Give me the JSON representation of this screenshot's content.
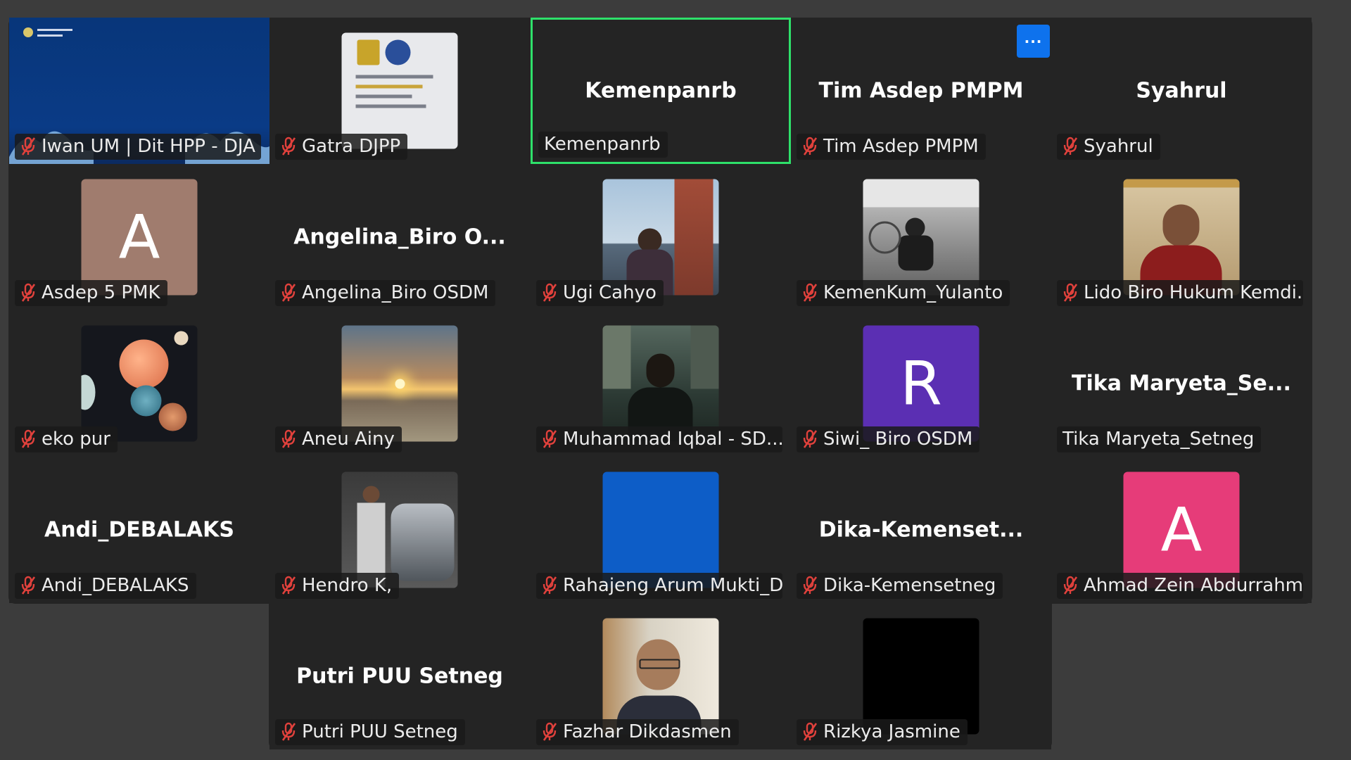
{
  "tiles": [
    {
      "row": 0,
      "col": 0,
      "name": "Iwan UM | Dit HPP - DJA",
      "center": "",
      "muted": true,
      "avatar": null,
      "photo": "slide-blue"
    },
    {
      "row": 0,
      "col": 1,
      "name": "Gatra DJPP",
      "center": "",
      "muted": true,
      "avatar": null,
      "photo": "document"
    },
    {
      "row": 0,
      "col": 2,
      "name": "Kemenpanrb",
      "center": "Kemenpanrb",
      "muted": false,
      "avatar": null,
      "photo": null,
      "active": true
    },
    {
      "row": 0,
      "col": 3,
      "name": "Tim Asdep PMPM",
      "center": "Tim Asdep PMPM",
      "muted": true,
      "avatar": null,
      "photo": null
    },
    {
      "row": 0,
      "col": 4,
      "name": "Syahrul",
      "center": "Syahrul",
      "muted": true,
      "avatar": null,
      "photo": null
    },
    {
      "row": 1,
      "col": 0,
      "name": "Asdep 5 PMK",
      "center": "",
      "muted": true,
      "avatar": {
        "letter": "A",
        "color": "#a07c6e"
      },
      "photo": null
    },
    {
      "row": 1,
      "col": 1,
      "name": "Angelina_Biro OSDM",
      "center": "Angelina_Biro  O...",
      "muted": true,
      "avatar": null,
      "photo": null
    },
    {
      "row": 1,
      "col": 2,
      "name": "Ugi Cahyo",
      "center": "",
      "muted": true,
      "avatar": null,
      "photo": "tower"
    },
    {
      "row": 1,
      "col": 3,
      "name": "KemenKum_Yulanto",
      "center": "",
      "muted": true,
      "avatar": null,
      "photo": "bw"
    },
    {
      "row": 1,
      "col": 4,
      "name": "Lido Biro Hukum Kemdi...",
      "center": "",
      "muted": true,
      "avatar": null,
      "photo": "portrait-red"
    },
    {
      "row": 2,
      "col": 0,
      "name": "eko pur",
      "center": "",
      "muted": true,
      "avatar": null,
      "photo": "planets"
    },
    {
      "row": 2,
      "col": 1,
      "name": "Aneu Ainy",
      "center": "",
      "muted": true,
      "avatar": null,
      "photo": "sunset"
    },
    {
      "row": 2,
      "col": 2,
      "name": "Muhammad Iqbal - SD...",
      "center": "",
      "muted": true,
      "avatar": null,
      "photo": "street"
    },
    {
      "row": 2,
      "col": 3,
      "name": "Siwi_ Biro OSDM",
      "center": "",
      "muted": true,
      "avatar": {
        "letter": "R",
        "color": "#5b2fb3"
      },
      "photo": null
    },
    {
      "row": 2,
      "col": 4,
      "name": "Tika Maryeta_Setneg",
      "center": "Tika  Maryeta_Se...",
      "muted": false,
      "avatar": null,
      "photo": null
    },
    {
      "row": 3,
      "col": 0,
      "name": "Andi_DEBALAKS",
      "center": "Andi_DEBALAKS",
      "muted": true,
      "avatar": null,
      "photo": null
    },
    {
      "row": 3,
      "col": 1,
      "name": "Hendro K,",
      "center": "",
      "muted": true,
      "avatar": null,
      "photo": "motorbike"
    },
    {
      "row": 3,
      "col": 2,
      "name": "Rahajeng Arum Mukti_Di...",
      "center": "",
      "muted": true,
      "avatar": null,
      "photo": "blue"
    },
    {
      "row": 3,
      "col": 3,
      "name": "Dika-Kemensetneg",
      "center": "Dika-Kemenset...",
      "muted": true,
      "avatar": null,
      "photo": null
    },
    {
      "row": 3,
      "col": 4,
      "name": "Ahmad Zein Abdurrahm...",
      "center": "",
      "muted": true,
      "avatar": {
        "letter": "A",
        "color": "#e63c79"
      },
      "photo": null
    },
    {
      "row": 4,
      "col": 1,
      "name": "Putri PUU Setneg",
      "center": "Putri PUU Setneg",
      "muted": true,
      "avatar": null,
      "photo": null
    },
    {
      "row": 4,
      "col": 2,
      "name": "Fazhar Dikdasmen",
      "center": "",
      "muted": true,
      "avatar": null,
      "photo": "office"
    },
    {
      "row": 4,
      "col": 3,
      "name": "Rizkya Jasmine",
      "center": "",
      "muted": true,
      "avatar": null,
      "photo": "black"
    }
  ],
  "colors": {
    "active_border": "#2ee06a",
    "mute_red": "#e0413c",
    "tile_bg": "#242424",
    "more_button": "#0e72ed"
  },
  "more_button": {
    "label": "···",
    "icon": "more-options-icon"
  }
}
